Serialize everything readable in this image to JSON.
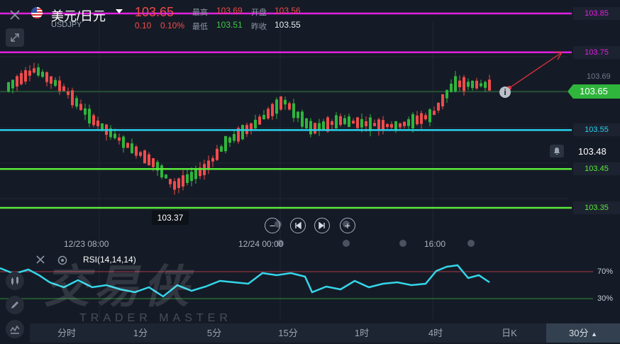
{
  "header": {
    "pair_name": "美元/日元",
    "pair_code": "USDJPY",
    "price": "103.65",
    "change": "0.10",
    "change_pct": "0.10%",
    "high_label": "最高",
    "high_value": "103.69",
    "open_label": "开盘",
    "open_value": "103.56",
    "low_label": "最低",
    "low_value": "103.51",
    "prev_close_label": "昨收",
    "prev_close_value": "103.55"
  },
  "levels": [
    {
      "value": "103.85",
      "color": "#e020e0"
    },
    {
      "value": "103.75",
      "color": "#e020e0"
    },
    {
      "value": "103.55",
      "color": "#27d2ee"
    },
    {
      "value": "103.45",
      "color": "#5bea3c"
    },
    {
      "value": "103.35",
      "color": "#5bea3c"
    }
  ],
  "axis_ticks": [
    "103.69",
    "103.48"
  ],
  "current_price": "103.65",
  "alert_price": "103.48",
  "low_marker": "103.37",
  "time_labels": [
    "12/23 08:00",
    "12/24 00:00",
    "16:00"
  ],
  "rsi": {
    "title": "RSI(14,14,14)",
    "upper": "70%",
    "lower": "30%",
    "color": "#33d6ea"
  },
  "watermark": {
    "main": "交易侠",
    "sub": "TRADER MASTER"
  },
  "tabs": [
    {
      "label": "分时",
      "selected": false
    },
    {
      "label": "1分",
      "selected": false
    },
    {
      "label": "5分",
      "selected": false
    },
    {
      "label": "15分",
      "selected": false
    },
    {
      "label": "1时",
      "selected": false
    },
    {
      "label": "4时",
      "selected": false
    },
    {
      "label": "日K",
      "selected": false
    },
    {
      "label": "30分",
      "selected": true
    }
  ],
  "colors": {
    "up": "#2fb53c",
    "down": "#f04b4b",
    "background": "#151b26"
  },
  "icons": {
    "close": "close-icon",
    "collapse": "collapse-icon",
    "zoom_out": "zoom-out-icon",
    "prev": "skip-back-icon",
    "next": "skip-forward-icon",
    "zoom_in": "zoom-in-icon",
    "bell": "bell-icon",
    "info": "info-icon",
    "settings": "gear-icon",
    "candles": "candlestick-icon",
    "pencil": "pencil-icon",
    "indicator": "indicator-icon"
  }
}
